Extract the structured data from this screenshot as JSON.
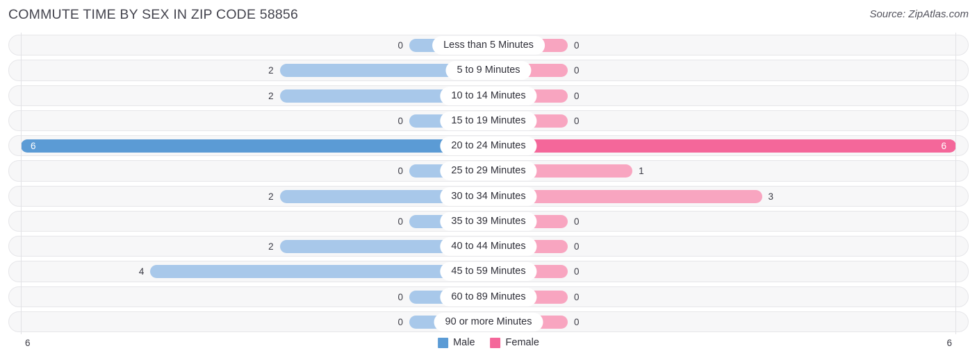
{
  "header": {
    "title": "COMMUTE TIME BY SEX IN ZIP CODE 58856",
    "source": "Source: ZipAtlas.com"
  },
  "legend": {
    "male_label": "Male",
    "female_label": "Female",
    "male_color": "#5b9bd5",
    "female_color": "#f4679a"
  },
  "axis": {
    "left_end": "6",
    "right_end": "6"
  },
  "colors": {
    "male_light": "#a8c8ea",
    "male_strong": "#5b9bd5",
    "female_light": "#f8a5c0",
    "female_strong": "#f4679a",
    "track_bg": "#f7f7f8",
    "track_border": "#e6e6e9"
  },
  "chart_data": {
    "type": "bar",
    "subtype": "diverging-butterfly",
    "title": "COMMUTE TIME BY SEX IN ZIP CODE 58856",
    "xlabel": "",
    "ylabel": "",
    "xlim": [
      0,
      6
    ],
    "grid": false,
    "legend_position": "bottom-center",
    "categories": [
      "Less than 5 Minutes",
      "5 to 9 Minutes",
      "10 to 14 Minutes",
      "15 to 19 Minutes",
      "20 to 24 Minutes",
      "25 to 29 Minutes",
      "30 to 34 Minutes",
      "35 to 39 Minutes",
      "40 to 44 Minutes",
      "45 to 59 Minutes",
      "60 to 89 Minutes",
      "90 or more Minutes"
    ],
    "series": [
      {
        "name": "Male",
        "side": "left",
        "color": "#5b9bd5",
        "values": [
          0,
          2,
          2,
          0,
          6,
          0,
          2,
          0,
          2,
          4,
          0,
          0
        ]
      },
      {
        "name": "Female",
        "side": "right",
        "color": "#f4679a",
        "values": [
          0,
          0,
          0,
          0,
          6,
          1,
          3,
          0,
          0,
          0,
          0,
          0
        ]
      }
    ]
  },
  "rows": [
    {
      "label": "Less than 5 Minutes",
      "male": "0",
      "female": "0"
    },
    {
      "label": "5 to 9 Minutes",
      "male": "2",
      "female": "0"
    },
    {
      "label": "10 to 14 Minutes",
      "male": "2",
      "female": "0"
    },
    {
      "label": "15 to 19 Minutes",
      "male": "0",
      "female": "0"
    },
    {
      "label": "20 to 24 Minutes",
      "male": "6",
      "female": "6"
    },
    {
      "label": "25 to 29 Minutes",
      "male": "0",
      "female": "1"
    },
    {
      "label": "30 to 34 Minutes",
      "male": "2",
      "female": "3"
    },
    {
      "label": "35 to 39 Minutes",
      "male": "0",
      "female": "0"
    },
    {
      "label": "40 to 44 Minutes",
      "male": "2",
      "female": "0"
    },
    {
      "label": "45 to 59 Minutes",
      "male": "4",
      "female": "0"
    },
    {
      "label": "60 to 89 Minutes",
      "male": "0",
      "female": "0"
    },
    {
      "label": "90 or more Minutes",
      "male": "0",
      "female": "0"
    }
  ]
}
